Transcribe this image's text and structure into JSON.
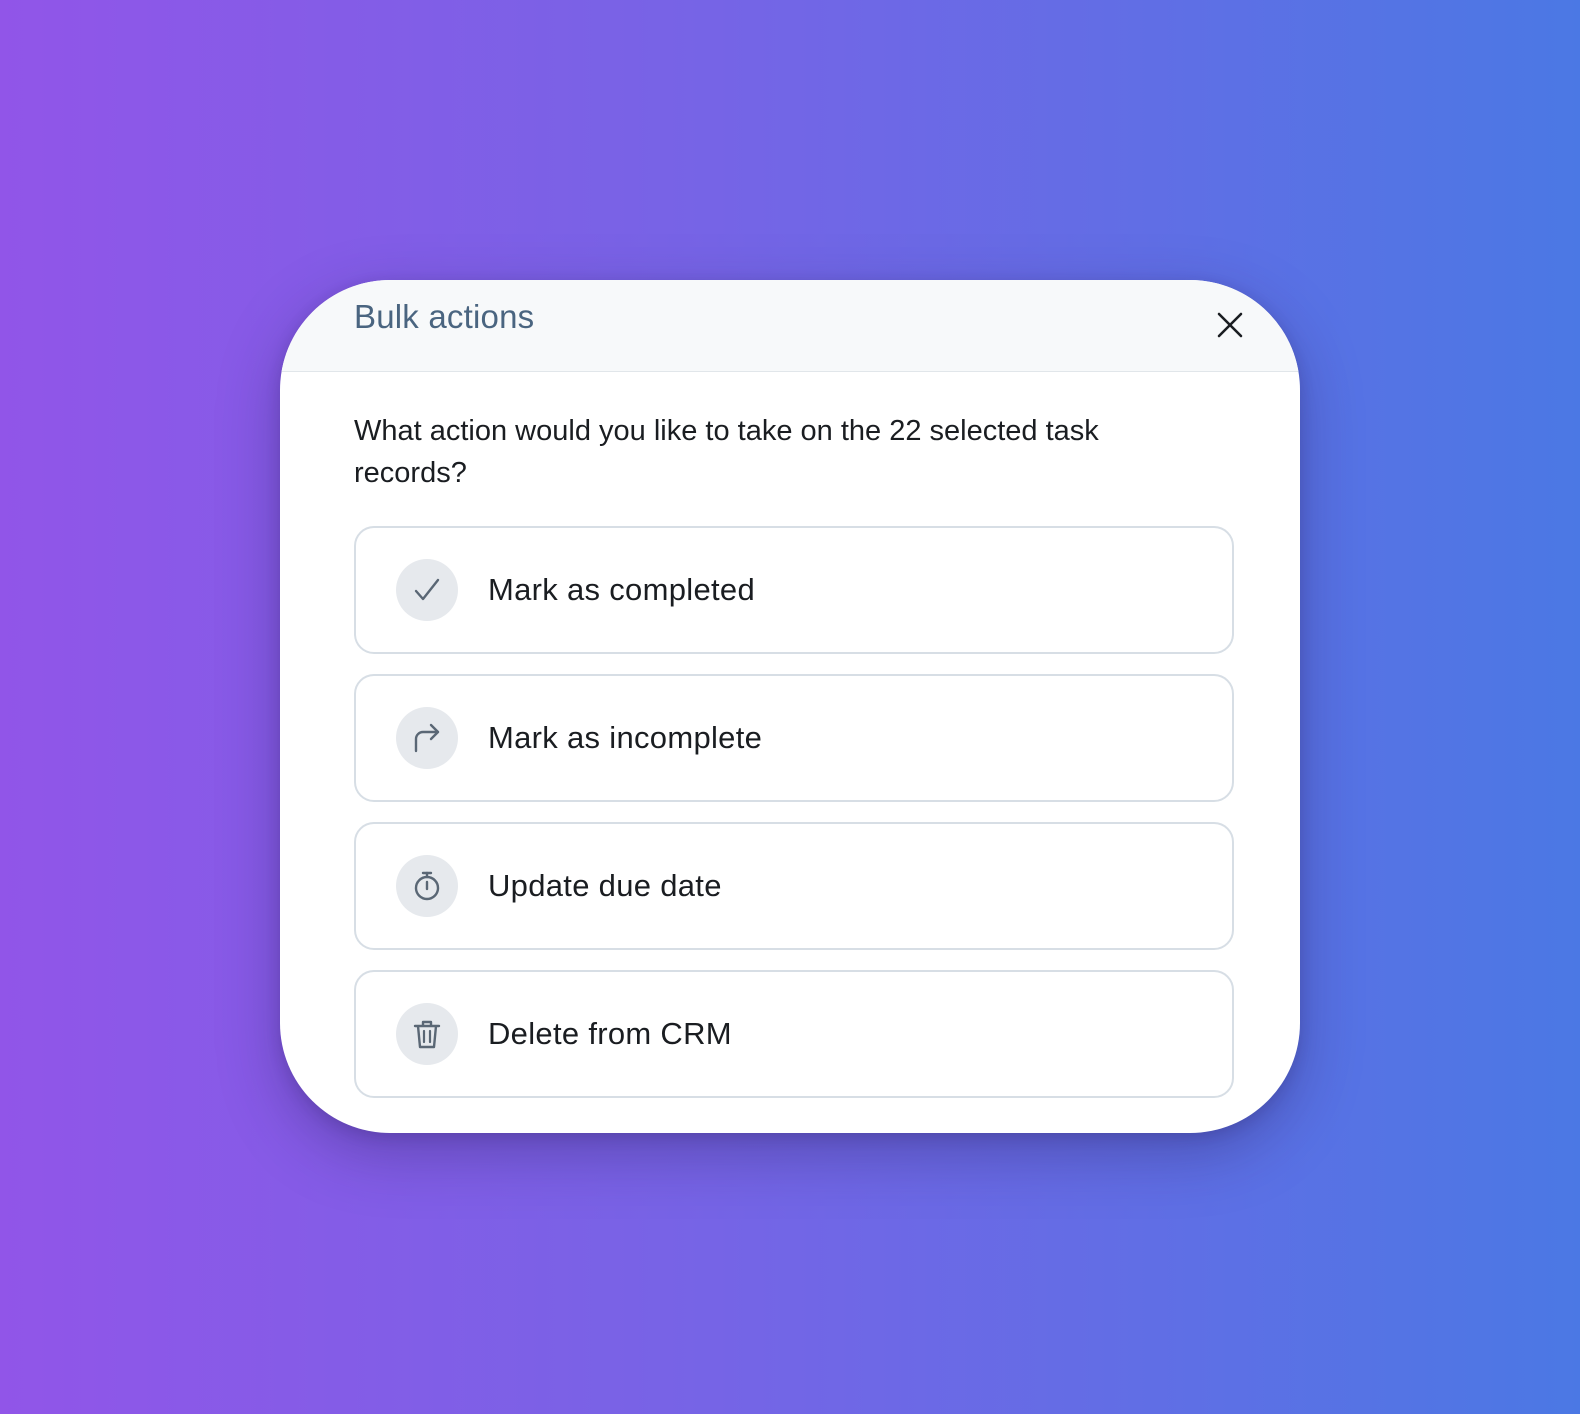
{
  "dialog": {
    "title": "Bulk actions",
    "prompt": "What action would you like to take on the 22 selected task records?",
    "close_icon": "close-icon",
    "options": [
      {
        "label": "Mark as completed",
        "icon": "check-icon"
      },
      {
        "label": "Mark as incomplete",
        "icon": "forward-arrow-icon"
      },
      {
        "label": "Update due date",
        "icon": "stopwatch-icon"
      },
      {
        "label": "Delete from CRM",
        "icon": "trash-icon"
      }
    ]
  },
  "colors": {
    "background_start": "#9155e8",
    "background_end": "#4b78e4",
    "title": "#4a6580",
    "icon_bg": "#e6e9ed",
    "icon_stroke": "#5a6775"
  }
}
